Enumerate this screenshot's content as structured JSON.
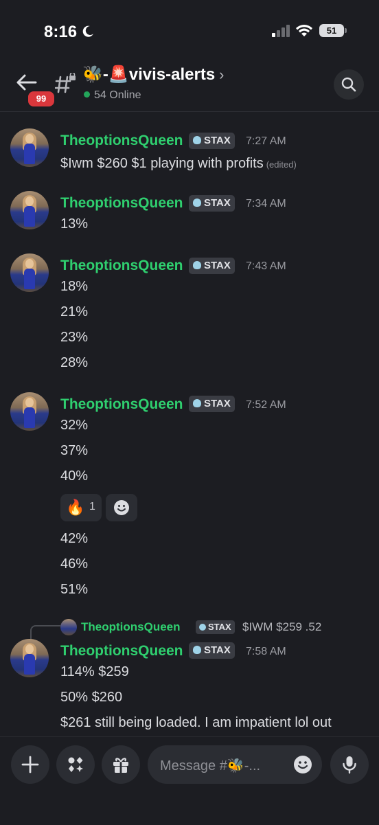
{
  "status_bar": {
    "time": "8:16",
    "battery": "51"
  },
  "header": {
    "back_badge": "99",
    "channel_name": "🐝-🚨vivis-alerts",
    "chevron": "›",
    "online": "54 Online"
  },
  "messages": [
    {
      "author": "TheoptionsQueen",
      "tag": "STAX",
      "time": "7:27 AM",
      "lines": [
        "$Iwm $260 $1 playing with profits"
      ],
      "edited": "(edited)"
    },
    {
      "author": "TheoptionsQueen",
      "tag": "STAX",
      "time": "7:34 AM",
      "lines": [
        "13%"
      ]
    },
    {
      "author": "TheoptionsQueen",
      "tag": "STAX",
      "time": "7:43 AM",
      "lines": [
        "18%",
        "21%",
        "23%",
        "28%"
      ]
    },
    {
      "author": "TheoptionsQueen",
      "tag": "STAX",
      "time": "7:52 AM",
      "lines": [
        "32%",
        "37%",
        "40%"
      ],
      "reaction": {
        "emoji": "🔥",
        "count": "1"
      },
      "lines_after": [
        "42%",
        "46%",
        "51%"
      ]
    },
    {
      "reply": {
        "author": "TheoptionsQueen",
        "tag": "STAX",
        "text": "$IWM $259 .52"
      },
      "author": "TheoptionsQueen",
      "tag": "STAX",
      "time": "7:58 AM",
      "lines": [
        "114% $259",
        "50% $260",
        "$261 still being loaded. I am impatient lol out"
      ]
    }
  ],
  "composer": {
    "placeholder": "Message #🐝-..."
  },
  "colors": {
    "username": "#2fcf6f",
    "background": "#1c1d22",
    "badge": "#da373c"
  },
  "icons": [
    "moon-icon",
    "signal-icon",
    "wifi-icon",
    "back-arrow-icon",
    "hashtag-lock-icon",
    "search-icon",
    "add-reaction-icon",
    "plus-icon",
    "apps-icon",
    "gift-icon",
    "emoji-icon",
    "mic-icon"
  ]
}
